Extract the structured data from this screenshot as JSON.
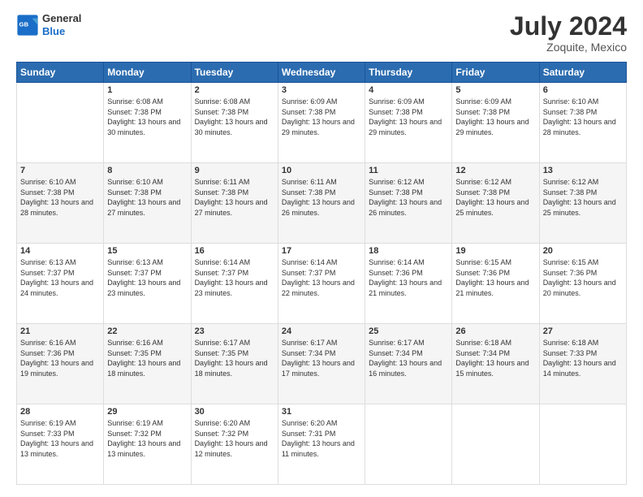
{
  "header": {
    "logo": {
      "line1": "General",
      "line2": "Blue"
    },
    "title": "July 2024",
    "subtitle": "Zoquite, Mexico"
  },
  "days_of_week": [
    "Sunday",
    "Monday",
    "Tuesday",
    "Wednesday",
    "Thursday",
    "Friday",
    "Saturday"
  ],
  "weeks": [
    [
      {
        "day": "",
        "sunrise": "",
        "sunset": "",
        "daylight": ""
      },
      {
        "day": "1",
        "sunrise": "Sunrise: 6:08 AM",
        "sunset": "Sunset: 7:38 PM",
        "daylight": "Daylight: 13 hours and 30 minutes."
      },
      {
        "day": "2",
        "sunrise": "Sunrise: 6:08 AM",
        "sunset": "Sunset: 7:38 PM",
        "daylight": "Daylight: 13 hours and 30 minutes."
      },
      {
        "day": "3",
        "sunrise": "Sunrise: 6:09 AM",
        "sunset": "Sunset: 7:38 PM",
        "daylight": "Daylight: 13 hours and 29 minutes."
      },
      {
        "day": "4",
        "sunrise": "Sunrise: 6:09 AM",
        "sunset": "Sunset: 7:38 PM",
        "daylight": "Daylight: 13 hours and 29 minutes."
      },
      {
        "day": "5",
        "sunrise": "Sunrise: 6:09 AM",
        "sunset": "Sunset: 7:38 PM",
        "daylight": "Daylight: 13 hours and 29 minutes."
      },
      {
        "day": "6",
        "sunrise": "Sunrise: 6:10 AM",
        "sunset": "Sunset: 7:38 PM",
        "daylight": "Daylight: 13 hours and 28 minutes."
      }
    ],
    [
      {
        "day": "7",
        "sunrise": "Sunrise: 6:10 AM",
        "sunset": "Sunset: 7:38 PM",
        "daylight": "Daylight: 13 hours and 28 minutes."
      },
      {
        "day": "8",
        "sunrise": "Sunrise: 6:10 AM",
        "sunset": "Sunset: 7:38 PM",
        "daylight": "Daylight: 13 hours and 27 minutes."
      },
      {
        "day": "9",
        "sunrise": "Sunrise: 6:11 AM",
        "sunset": "Sunset: 7:38 PM",
        "daylight": "Daylight: 13 hours and 27 minutes."
      },
      {
        "day": "10",
        "sunrise": "Sunrise: 6:11 AM",
        "sunset": "Sunset: 7:38 PM",
        "daylight": "Daylight: 13 hours and 26 minutes."
      },
      {
        "day": "11",
        "sunrise": "Sunrise: 6:12 AM",
        "sunset": "Sunset: 7:38 PM",
        "daylight": "Daylight: 13 hours and 26 minutes."
      },
      {
        "day": "12",
        "sunrise": "Sunrise: 6:12 AM",
        "sunset": "Sunset: 7:38 PM",
        "daylight": "Daylight: 13 hours and 25 minutes."
      },
      {
        "day": "13",
        "sunrise": "Sunrise: 6:12 AM",
        "sunset": "Sunset: 7:38 PM",
        "daylight": "Daylight: 13 hours and 25 minutes."
      }
    ],
    [
      {
        "day": "14",
        "sunrise": "Sunrise: 6:13 AM",
        "sunset": "Sunset: 7:37 PM",
        "daylight": "Daylight: 13 hours and 24 minutes."
      },
      {
        "day": "15",
        "sunrise": "Sunrise: 6:13 AM",
        "sunset": "Sunset: 7:37 PM",
        "daylight": "Daylight: 13 hours and 23 minutes."
      },
      {
        "day": "16",
        "sunrise": "Sunrise: 6:14 AM",
        "sunset": "Sunset: 7:37 PM",
        "daylight": "Daylight: 13 hours and 23 minutes."
      },
      {
        "day": "17",
        "sunrise": "Sunrise: 6:14 AM",
        "sunset": "Sunset: 7:37 PM",
        "daylight": "Daylight: 13 hours and 22 minutes."
      },
      {
        "day": "18",
        "sunrise": "Sunrise: 6:14 AM",
        "sunset": "Sunset: 7:36 PM",
        "daylight": "Daylight: 13 hours and 21 minutes."
      },
      {
        "day": "19",
        "sunrise": "Sunrise: 6:15 AM",
        "sunset": "Sunset: 7:36 PM",
        "daylight": "Daylight: 13 hours and 21 minutes."
      },
      {
        "day": "20",
        "sunrise": "Sunrise: 6:15 AM",
        "sunset": "Sunset: 7:36 PM",
        "daylight": "Daylight: 13 hours and 20 minutes."
      }
    ],
    [
      {
        "day": "21",
        "sunrise": "Sunrise: 6:16 AM",
        "sunset": "Sunset: 7:36 PM",
        "daylight": "Daylight: 13 hours and 19 minutes."
      },
      {
        "day": "22",
        "sunrise": "Sunrise: 6:16 AM",
        "sunset": "Sunset: 7:35 PM",
        "daylight": "Daylight: 13 hours and 18 minutes."
      },
      {
        "day": "23",
        "sunrise": "Sunrise: 6:17 AM",
        "sunset": "Sunset: 7:35 PM",
        "daylight": "Daylight: 13 hours and 18 minutes."
      },
      {
        "day": "24",
        "sunrise": "Sunrise: 6:17 AM",
        "sunset": "Sunset: 7:34 PM",
        "daylight": "Daylight: 13 hours and 17 minutes."
      },
      {
        "day": "25",
        "sunrise": "Sunrise: 6:17 AM",
        "sunset": "Sunset: 7:34 PM",
        "daylight": "Daylight: 13 hours and 16 minutes."
      },
      {
        "day": "26",
        "sunrise": "Sunrise: 6:18 AM",
        "sunset": "Sunset: 7:34 PM",
        "daylight": "Daylight: 13 hours and 15 minutes."
      },
      {
        "day": "27",
        "sunrise": "Sunrise: 6:18 AM",
        "sunset": "Sunset: 7:33 PM",
        "daylight": "Daylight: 13 hours and 14 minutes."
      }
    ],
    [
      {
        "day": "28",
        "sunrise": "Sunrise: 6:19 AM",
        "sunset": "Sunset: 7:33 PM",
        "daylight": "Daylight: 13 hours and 13 minutes."
      },
      {
        "day": "29",
        "sunrise": "Sunrise: 6:19 AM",
        "sunset": "Sunset: 7:32 PM",
        "daylight": "Daylight: 13 hours and 13 minutes."
      },
      {
        "day": "30",
        "sunrise": "Sunrise: 6:20 AM",
        "sunset": "Sunset: 7:32 PM",
        "daylight": "Daylight: 13 hours and 12 minutes."
      },
      {
        "day": "31",
        "sunrise": "Sunrise: 6:20 AM",
        "sunset": "Sunset: 7:31 PM",
        "daylight": "Daylight: 13 hours and 11 minutes."
      },
      {
        "day": "",
        "sunrise": "",
        "sunset": "",
        "daylight": ""
      },
      {
        "day": "",
        "sunrise": "",
        "sunset": "",
        "daylight": ""
      },
      {
        "day": "",
        "sunrise": "",
        "sunset": "",
        "daylight": ""
      }
    ]
  ]
}
